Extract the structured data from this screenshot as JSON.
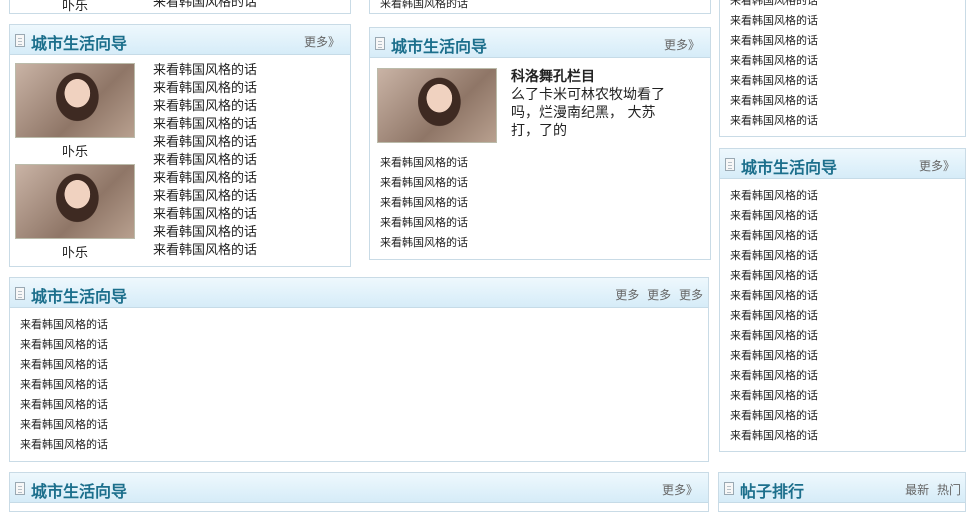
{
  "top_left_partial": {
    "caption": "卟乐",
    "item": "来看韩国风格的话"
  },
  "top_mid_partial": {
    "item": "来看韩国风格的话"
  },
  "right_top_list": {
    "items": [
      "来看韩国风格的话",
      "来看韩国风格的话",
      "来看韩国风格的话",
      "来看韩国风格的话",
      "来看韩国风格的话",
      "来看韩国风格的话",
      "来看韩国风格的话"
    ]
  },
  "panel_a": {
    "title": "城市生活向导",
    "more": "更多》",
    "photos": [
      {
        "caption": "卟乐"
      },
      {
        "caption": "卟乐"
      }
    ],
    "items": [
      "来看韩国风格的话",
      "来看韩国风格的话",
      "来看韩国风格的话",
      "来看韩国风格的话",
      "来看韩国风格的话",
      "来看韩国风格的话",
      "来看韩国风格的话",
      "来看韩国风格的话",
      "来看韩国风格的话",
      "来看韩国风格的话",
      "来看韩国风格的话"
    ]
  },
  "panel_b": {
    "title": "城市生活向导",
    "more": "更多》",
    "feature_title": "科洛舞孔栏目",
    "feature_lines": [
      "么了卡米可林农牧坳看了",
      "吗，烂漫南纪黑，  大苏",
      "打，了的"
    ],
    "items": [
      "来看韩国风格的话",
      "来看韩国风格的话",
      "来看韩国风格的话",
      "来看韩国风格的话",
      "来看韩国风格的话"
    ]
  },
  "panel_c": {
    "title": "城市生活向导",
    "more": "更多》",
    "items": [
      "来看韩国风格的话",
      "来看韩国风格的话",
      "来看韩国风格的话",
      "来看韩国风格的话",
      "来看韩国风格的话",
      "来看韩国风格的话",
      "来看韩国风格的话",
      "来看韩国风格的话",
      "来看韩国风格的话",
      "来看韩国风格的话",
      "来看韩国风格的话",
      "来看韩国风格的话",
      "来看韩国风格的话"
    ]
  },
  "panel_d": {
    "title": "城市生活向导",
    "more_links": [
      "更多",
      "更多",
      "更多"
    ],
    "items": [
      "来看韩国风格的话",
      "来看韩国风格的话",
      "来看韩国风格的话",
      "来看韩国风格的话",
      "来看韩国风格的话",
      "来看韩国风格的话",
      "来看韩国风格的话"
    ]
  },
  "panel_e": {
    "title": "城市生活向导",
    "more": "更多》"
  },
  "panel_f": {
    "title": "帖子排行",
    "tabs": [
      "最新",
      "热门"
    ]
  }
}
